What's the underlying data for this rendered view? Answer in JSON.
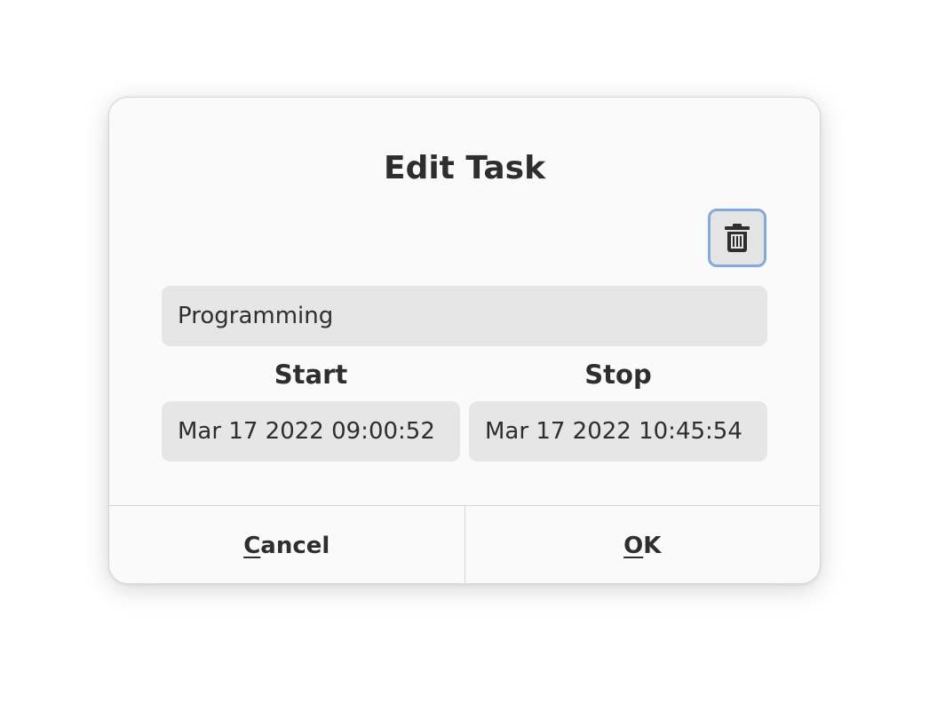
{
  "dialog": {
    "title": "Edit Task",
    "delete_icon": "trash-icon",
    "task_name": "Programming",
    "start": {
      "label": "Start",
      "value": "Mar 17 2022 09:00:52"
    },
    "stop": {
      "label": "Stop",
      "value": "Mar 17 2022 10:45:54"
    },
    "buttons": {
      "cancel": {
        "mnemonic": "C",
        "rest": "ancel"
      },
      "ok": {
        "mnemonic": "O",
        "rest": "K"
      }
    }
  },
  "colors": {
    "focus_ring": "#84a9dc",
    "entry_bg": "#e6e6e6",
    "dialog_bg": "#fafafa"
  }
}
